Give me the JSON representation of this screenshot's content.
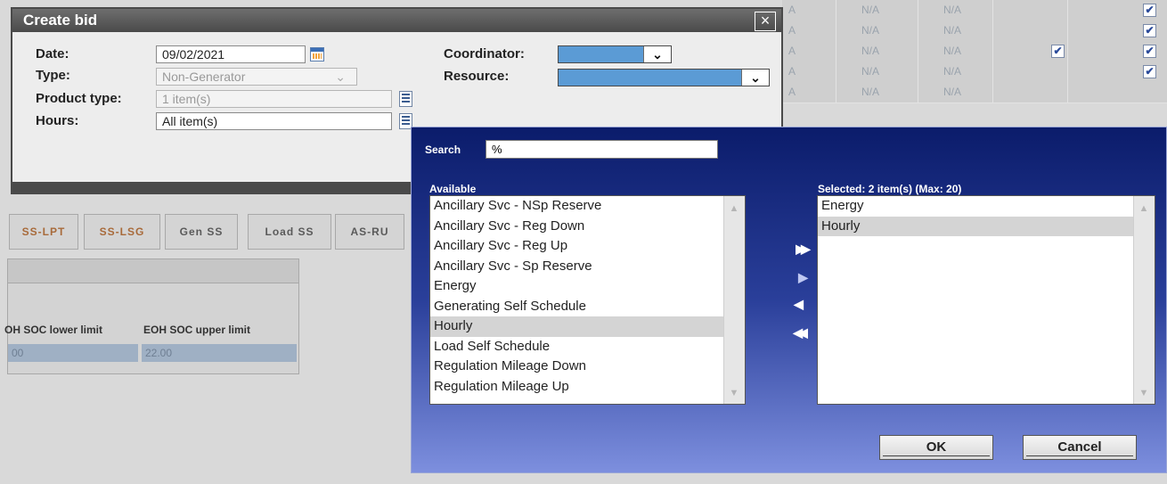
{
  "background_grid": {
    "rows": [
      {
        "c2": "N/A",
        "c3": "N/A",
        "chk4": false,
        "chk5": true
      },
      {
        "c2": "N/A",
        "c3": "N/A",
        "chk4": false,
        "chk5": true
      },
      {
        "c2": "N/A",
        "c3": "N/A",
        "chk4": true,
        "chk5": true
      },
      {
        "c2": "N/A",
        "c3": "N/A",
        "chk4": false,
        "chk5": true
      },
      {
        "c2": "N/A",
        "c3": "N/A",
        "chk4": false,
        "chk5": false
      }
    ],
    "left_fragment": "A"
  },
  "background_tabs": [
    "SS-LPT",
    "SS-LSG",
    "Gen SS",
    "Load SS",
    "AS-RU"
  ],
  "background_table": {
    "col1_header": "OH SOC lower limit",
    "col2_header": "EOH SOC upper limit",
    "col1_value": "00",
    "col2_value": "22.00"
  },
  "dialog": {
    "title": "Create bid",
    "close_label": "×",
    "date_label": "Date:",
    "date_value": "09/02/2021",
    "type_label": "Type:",
    "type_value": "Non-Generator",
    "product_type_label": "Product type:",
    "product_type_value": "1 item(s)",
    "hours_label": "Hours:",
    "hours_value": "All item(s)",
    "coordinator_label": "Coordinator:",
    "resource_label": "Resource:",
    "dropdown_arrow": "⌄"
  },
  "popup": {
    "search_label": "Search",
    "search_value": "%",
    "available_label": "Available",
    "selected_label": "Selected: 2 item(s) (Max: 20)",
    "available_items": [
      {
        "label": "Ancillary Svc - NSp Reserve",
        "highlighted": false
      },
      {
        "label": "Ancillary Svc - Reg Down",
        "highlighted": false
      },
      {
        "label": "Ancillary Svc - Reg Up",
        "highlighted": false
      },
      {
        "label": "Ancillary Svc - Sp Reserve",
        "highlighted": false
      },
      {
        "label": "Energy",
        "highlighted": false
      },
      {
        "label": "Generating Self Schedule",
        "highlighted": false
      },
      {
        "label": "Hourly",
        "highlighted": true
      },
      {
        "label": "Load Self Schedule",
        "highlighted": false
      },
      {
        "label": "Regulation Mileage Down",
        "highlighted": false
      },
      {
        "label": "Regulation Mileage Up",
        "highlighted": false
      }
    ],
    "selected_items": [
      {
        "label": "Energy",
        "highlighted": false
      },
      {
        "label": "Hourly",
        "highlighted": true
      }
    ],
    "move_all_right": "▶▶",
    "move_right": "▶",
    "move_left": "◀",
    "move_all_left": "◀◀",
    "ok_label": "OK",
    "cancel_label": "Cancel"
  },
  "colors": {
    "popup_gradient_top": "#0b1c6b",
    "popup_gradient_bottom": "#7d8fde",
    "dropdown_fill": "#5b9bd5",
    "titlebar": "#4a4a4a"
  }
}
